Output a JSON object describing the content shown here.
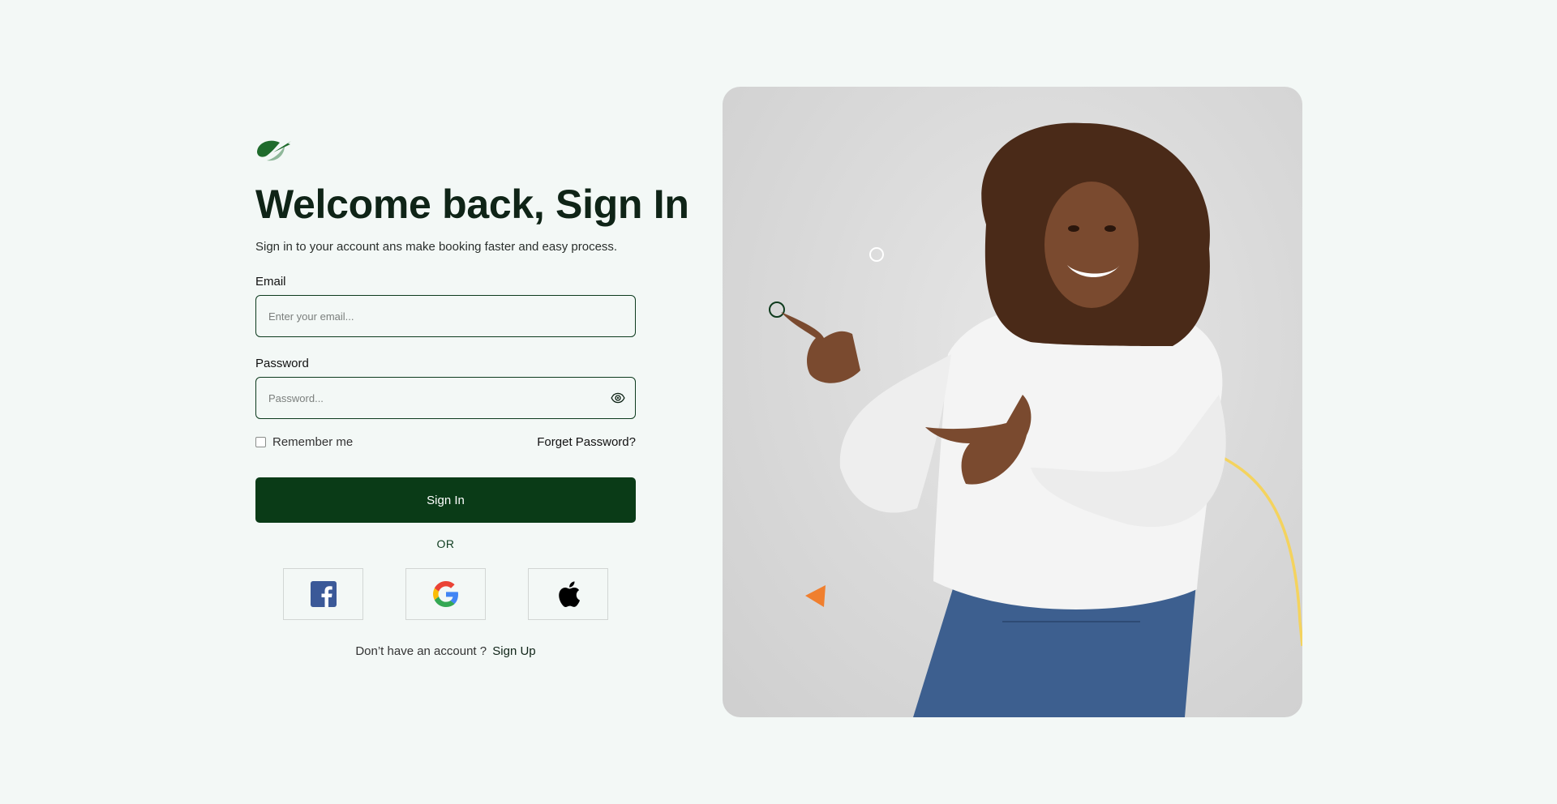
{
  "logo": {
    "icon": "leaf-logo-icon",
    "color": "#1f6b2c"
  },
  "header": {
    "title": "Welcome back, Sign In",
    "subtitle": "Sign in to your account ans make booking faster and easy process."
  },
  "form": {
    "email": {
      "label": "Email",
      "placeholder": "Enter your email..."
    },
    "password": {
      "label": "Password",
      "placeholder": "Password...",
      "toggle_icon": "eye-icon"
    },
    "remember_label": "Remember me",
    "forgot_label": "Forget Password?",
    "submit_label": "Sign In",
    "divider_label": "OR"
  },
  "social": [
    {
      "name": "facebook",
      "icon": "facebook-icon",
      "color": "#3b5998"
    },
    {
      "name": "google",
      "icon": "google-icon"
    },
    {
      "name": "apple",
      "icon": "apple-icon",
      "color": "#000000"
    }
  ],
  "signup": {
    "prompt": "Don’t have an account ?",
    "link_label": "Sign Up"
  },
  "hero": {
    "description_icon": "smiling-woman-pointing-image",
    "accent_colors": {
      "circle": "#0f3b1e",
      "triangle": "#f07f2e",
      "curve": "#f4d35e"
    }
  },
  "colors": {
    "background": "#f3f8f6",
    "primary": "#0a3b17",
    "heading": "#0f2417"
  }
}
